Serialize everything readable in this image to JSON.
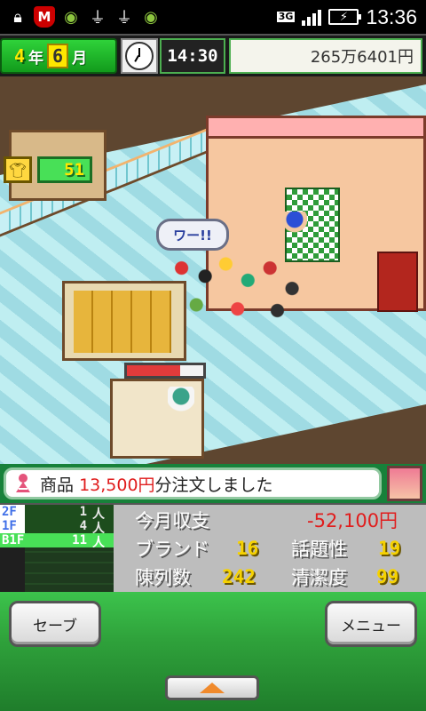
{
  "status_bar": {
    "network": "3G",
    "time": "13:36",
    "icons": [
      "lock-icon",
      "mcafee-shield-icon",
      "android-debug-icon",
      "usb-icon",
      "usb-icon",
      "android-icon",
      "signal-icon",
      "battery-charging-icon"
    ]
  },
  "hud": {
    "year": "4",
    "year_unit": "年",
    "month": "6",
    "month_unit": "月",
    "time": "14:30",
    "money": "265万6401円"
  },
  "badges": {
    "shirt_icon": "shirt-icon",
    "count": "51"
  },
  "world": {
    "speech": "ワー!!",
    "progress_fraction": 0.7
  },
  "message": {
    "prefix": "商品",
    "amount": "13,500円",
    "suffix": "分注文しました"
  },
  "floors": [
    {
      "label": "2F",
      "count_a": "1",
      "count_b": "人"
    },
    {
      "label": "1F",
      "count_a": "4",
      "count_b": "人"
    },
    {
      "label": "B1F",
      "count_a": "11",
      "count_b": "人"
    }
  ],
  "stats": {
    "income_label": "今月収支",
    "income_value": "-52,100円",
    "brand_label": "ブランド",
    "brand_value": "16",
    "topic_label": "話題性",
    "topic_value": "19",
    "display_label": "陳列数",
    "display_value": "242",
    "clean_label": "清潔度",
    "clean_value": "99"
  },
  "buttons": {
    "save": "セーブ",
    "menu": "メニュー"
  },
  "colors": {
    "accent_green": "#2fa23b",
    "money_negative": "#e01d1d",
    "stat_yellow": "#f6d200"
  }
}
